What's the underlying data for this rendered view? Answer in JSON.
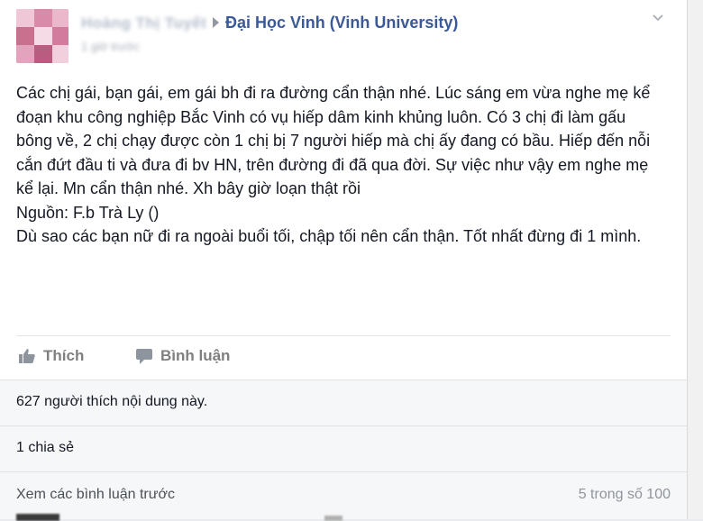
{
  "post": {
    "author_name": "Hoàng Thị Tuyết",
    "group_name": "Đại Học Vinh (Vinh University)",
    "timestamp": "1 giờ trước",
    "body_lines": [
      "Các chị gái, bạn gái, em gái bh đi ra đường cẩn thận nhé. Lúc sáng em vừa nghe mẹ kể đoạn khu công nghiệp Bắc Vinh có vụ hiếp dâm kinh khủng luôn. Có 3 chị đi làm gấu bông về, 2 chị chạy được còn 1 chị bị 7 người hiếp mà chị ấy đang có bầu. Hiếp đến nỗi cắn đứt đầu ti và đưa đi bv HN, trên đường đi đã qua đời. Sự việc như vậy em nghe mẹ kể lại. Mn cẩn thận nhé. Xh bây giờ loạn thật rồi",
      "Nguồn: F.b Trà Ly ()",
      "Dù sao các bạn nữ đi ra ngoài buổi tối, chập tối nên cẩn thận. Tốt nhất đừng đi 1 mình."
    ]
  },
  "actions": {
    "like_label": "Thích",
    "comment_label": "Bình luận"
  },
  "stats": {
    "likes_text": "627 người thích nội dung này.",
    "shares_text": "1 chia sẻ",
    "view_previous_label": "Xem các bình luận trước",
    "comment_count_text": "5 trong số 100"
  },
  "icons": {
    "like": "thumbs-up-icon",
    "comment": "speech-bubble-icon",
    "menu": "chevron-down-icon",
    "arrow": "right-arrow-icon"
  },
  "colors": {
    "link_blue": "#3b5998",
    "action_gray": "#7f7f7f",
    "band_bg": "#f6f7f9"
  }
}
